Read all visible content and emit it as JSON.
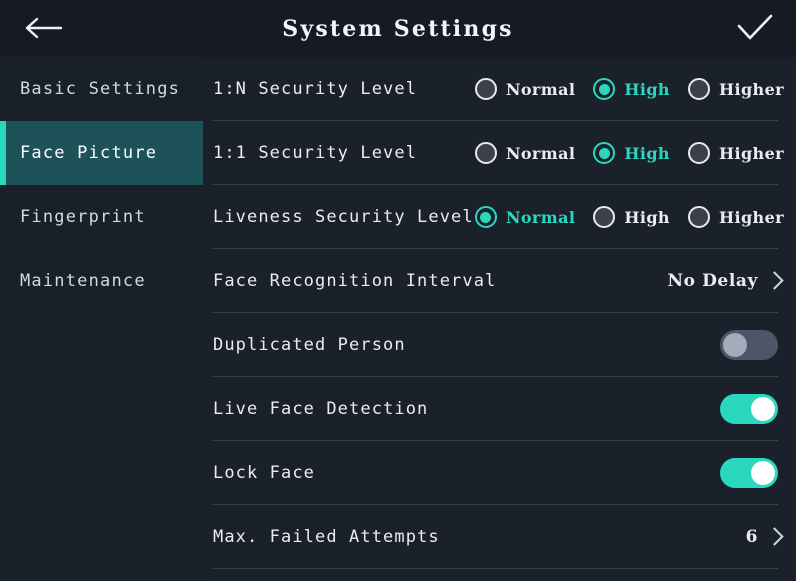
{
  "header": {
    "title": "System Settings",
    "back_icon": "arrow-left-icon",
    "confirm_icon": "check-icon"
  },
  "sidebar": {
    "items": [
      {
        "label": "Basic Settings",
        "active": false
      },
      {
        "label": "Face Picture",
        "active": true
      },
      {
        "label": "Fingerprint",
        "active": false
      },
      {
        "label": "Maintenance",
        "active": false
      }
    ]
  },
  "settings": {
    "rows": [
      {
        "name": "security-level-1n",
        "label": "1:N Security Level",
        "type": "radio",
        "options": [
          "Normal",
          "High",
          "Higher"
        ],
        "selected": "High"
      },
      {
        "name": "security-level-11",
        "label": "1:1 Security Level",
        "type": "radio",
        "options": [
          "Normal",
          "High",
          "Higher"
        ],
        "selected": "High"
      },
      {
        "name": "liveness-security-level",
        "label": "Liveness Security Level",
        "type": "radio",
        "options": [
          "Normal",
          "High",
          "Higher"
        ],
        "selected": "Normal"
      },
      {
        "name": "face-recognition-interval",
        "label": "Face Recognition Interval",
        "type": "nav",
        "value": "No Delay"
      },
      {
        "name": "duplicated-person",
        "label": "Duplicated Person",
        "type": "toggle",
        "value": "off"
      },
      {
        "name": "live-face-detection",
        "label": "Live Face Detection",
        "type": "toggle",
        "value": "on"
      },
      {
        "name": "lock-face",
        "label": "Lock Face",
        "type": "toggle",
        "value": "on"
      },
      {
        "name": "max-failed-attempts",
        "label": "Max. Failed Attempts",
        "type": "nav",
        "value": "6"
      }
    ]
  },
  "colors": {
    "accent": "#2ad8c0",
    "background": "#1b212a",
    "header_background": "#161b23",
    "sidebar_background": "#1a202a",
    "sidebar_active_background": "#1d5259",
    "divider": "#39414d",
    "text": "#e8edf2",
    "toggle_off_track": "#4e5568",
    "toggle_off_knob": "#a6abbb"
  }
}
